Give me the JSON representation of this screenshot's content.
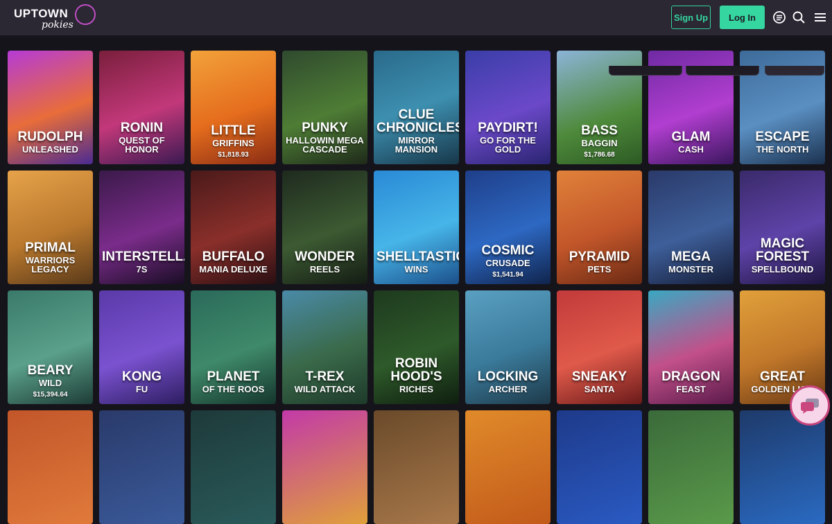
{
  "header": {
    "logo_text_top": "UPTOWN",
    "logo_text_bottom": "pokies",
    "signup_label": "Sign Up",
    "login_label": "Log In",
    "icons": [
      "menu-list-icon",
      "search-icon",
      "hamburger-icon"
    ]
  },
  "colors": {
    "accent": "#35d6a0",
    "header_bg": "#2b2733",
    "page_bg": "#16141b",
    "chat_border": "#c9467e"
  },
  "games": [
    {
      "title": "Rudolph",
      "sub": "Unleashed",
      "jackpot": "",
      "bg": "linear-gradient(160deg,#b53bd6 0%,#e86d3a 55%,#4a2a92 100%)"
    },
    {
      "title": "Ronin",
      "sub": "Quest of Honor",
      "jackpot": "",
      "bg": "linear-gradient(160deg,#7a1f3c 0%,#c2387a 55%,#3b1a52 100%)"
    },
    {
      "title": "Little",
      "sub": "Griffins",
      "jackpot": "$1,818.93",
      "bg": "linear-gradient(160deg,#f2a23a 0%,#e56d1d 55%,#8a2c14 100%)"
    },
    {
      "title": "Punky",
      "sub": "Hallowin Mega Cascade",
      "jackpot": "",
      "bg": "linear-gradient(160deg,#2f4a2e 0%,#4e7d35 55%,#1e2a1a 100%)"
    },
    {
      "title": "Clue Chronicles",
      "sub": "Mirror Mansion",
      "jackpot": "",
      "bg": "linear-gradient(160deg,#2a6a8a 0%,#3d8fb0 50%,#173749 100%)"
    },
    {
      "title": "Paydirt!",
      "sub": "Go for the Gold",
      "jackpot": "",
      "bg": "linear-gradient(160deg,#3a3ea8 0%,#6b49c9 55%,#2a2470 100%)"
    },
    {
      "title": "Bass",
      "sub": "Baggin",
      "jackpot": "$1,786.68",
      "bg": "linear-gradient(160deg,#8cb4d8 0%,#4e8a3b 60%,#2d5a24 100%)"
    },
    {
      "title": "Glam",
      "sub": "Cash",
      "jackpot": "",
      "bg": "linear-gradient(160deg,#6e2aa2 0%,#b13ed0 55%,#3b165e 100%)"
    },
    {
      "title": "Escape",
      "sub": "The North",
      "jackpot": "",
      "bg": "linear-gradient(160deg,#3d6b99 0%,#5a8fc2 55%,#1b3250 100%)"
    },
    {
      "title": "Primal",
      "sub": "Warriors Legacy",
      "jackpot": "",
      "bg": "linear-gradient(160deg,#e6a34a 0%,#b9782d 55%,#5a3a1a 100%)"
    },
    {
      "title": "Interstellar",
      "sub": "7s",
      "jackpot": "",
      "bg": "linear-gradient(160deg,#3b1a4a 0%,#7a2c8a 55%,#1a0d25 100%)"
    },
    {
      "title": "Buffalo",
      "sub": "Mania Deluxe",
      "jackpot": "",
      "bg": "linear-gradient(160deg,#4a1a1a 0%,#8a2f2a 55%,#2a0f12 100%)"
    },
    {
      "title": "Wonder",
      "sub": "Reels",
      "jackpot": "",
      "bg": "linear-gradient(160deg,#1e2a1e 0%,#3c5a32 55%,#141c14 100%)"
    },
    {
      "title": "Shelltastic",
      "sub": "Wins",
      "jackpot": "",
      "bg": "linear-gradient(160deg,#2a8ad6 0%,#46b5e8 55%,#1c4f8a 100%)"
    },
    {
      "title": "Cosmic",
      "sub": "Crusade",
      "jackpot": "$1,541.94",
      "bg": "linear-gradient(160deg,#1f3f8a 0%,#2d68c2 55%,#10244d 100%)"
    },
    {
      "title": "Pyramid",
      "sub": "Pets",
      "jackpot": "",
      "bg": "linear-gradient(160deg,#e0823a 0%,#c2562a 55%,#6a2a14 100%)"
    },
    {
      "title": "Mega",
      "sub": "Monster",
      "jackpot": "",
      "bg": "linear-gradient(160deg,#2a3a6a 0%,#3e5f9a 55%,#151d38 100%)"
    },
    {
      "title": "Magic Forest",
      "sub": "Spellbound",
      "jackpot": "",
      "bg": "linear-gradient(160deg,#3a2a6a 0%,#5e43a8 55%,#1e1540 100%)"
    },
    {
      "title": "Beary",
      "sub": "Wild",
      "jackpot": "$15,394.64",
      "bg": "linear-gradient(160deg,#3a7a6a 0%,#5aa08a 55%,#1e3d36 100%)"
    },
    {
      "title": "Kong",
      "sub": "Fu",
      "jackpot": "",
      "bg": "linear-gradient(160deg,#5a3aa8 0%,#7a52d0 55%,#2e1e62 100%)"
    },
    {
      "title": "Planet",
      "sub": "of the Roos",
      "jackpot": "",
      "bg": "linear-gradient(160deg,#2a6a5a 0%,#3f8a6a 55%,#15362c 100%)"
    },
    {
      "title": "T-Rex",
      "sub": "Wild Attack",
      "jackpot": "",
      "bg": "linear-gradient(160deg,#4a8aa8 0%,#3a6a4a 55%,#1e3a2a 100%)"
    },
    {
      "title": "Robin Hood's",
      "sub": "Riches",
      "jackpot": "",
      "bg": "linear-gradient(160deg,#1e3a1e 0%,#2e5a2a 55%,#0f1e0f 100%)"
    },
    {
      "title": "Locking",
      "sub": "Archer",
      "jackpot": "",
      "bg": "linear-gradient(160deg,#5aa0c2 0%,#3a7a9a 55%,#1e3a4a 100%)"
    },
    {
      "title": "Sneaky",
      "sub": "Santa",
      "jackpot": "",
      "bg": "linear-gradient(160deg,#c23a3a 0%,#e05a4a 55%,#6a1a1a 100%)"
    },
    {
      "title": "Dragon",
      "sub": "Feast",
      "jackpot": "",
      "bg": "linear-gradient(160deg,#3aa8c2 0%,#c2508a 55%,#5a1a4a 100%)"
    },
    {
      "title": "Great",
      "sub": "Golden Lion",
      "jackpot": "",
      "bg": "linear-gradient(160deg,#e0a03a 0%,#c2782a 55%,#6a3a14 100%)"
    },
    {
      "title": "",
      "sub": "",
      "jackpot": "",
      "bg": "linear-gradient(160deg,#c2562a 0%,#e07a3a 100%)"
    },
    {
      "title": "",
      "sub": "",
      "jackpot": "",
      "bg": "linear-gradient(160deg,#2a3a6a 0%,#3a5a9a 100%)"
    },
    {
      "title": "",
      "sub": "",
      "jackpot": "",
      "bg": "linear-gradient(160deg,#1e3a3a 0%,#2a5a5a 100%)"
    },
    {
      "title": "",
      "sub": "",
      "jackpot": "",
      "bg": "linear-gradient(160deg,#c23aa8 0%,#e0a03a 100%)"
    },
    {
      "title": "",
      "sub": "",
      "jackpot": "",
      "bg": "linear-gradient(160deg,#6a4a2a 0%,#a8784a 100%)"
    },
    {
      "title": "",
      "sub": "",
      "jackpot": "",
      "bg": "linear-gradient(160deg,#e08a2a 0%,#c25a1a 100%)"
    },
    {
      "title": "",
      "sub": "",
      "jackpot": "",
      "bg": "linear-gradient(160deg,#1e3a8a 0%,#2a5ac2 100%)"
    },
    {
      "title": "",
      "sub": "",
      "jackpot": "",
      "bg": "linear-gradient(160deg,#3a6a3a 0%,#5a9a4a 100%)"
    },
    {
      "title": "",
      "sub": "",
      "jackpot": "",
      "bg": "linear-gradient(160deg,#1e3a6a 0%,#2a6ac2 100%)"
    }
  ]
}
